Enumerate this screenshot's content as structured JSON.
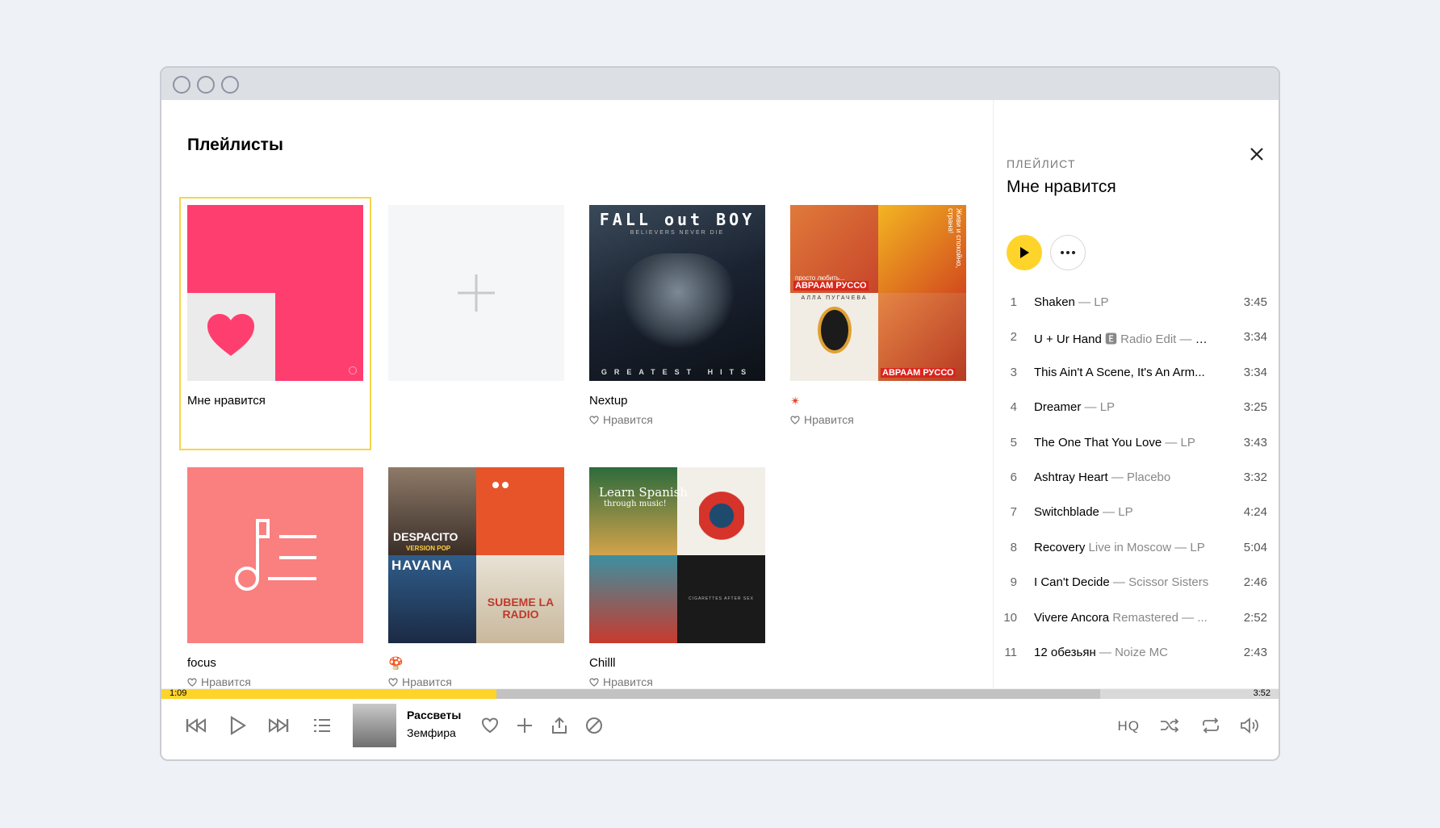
{
  "section_title": "Плейлисты",
  "playlists": [
    {
      "name": "Мне нравится",
      "meta": ""
    },
    {
      "name": "",
      "meta": ""
    },
    {
      "name": "Nextup",
      "meta": "Нравится",
      "cover_text_top": "FALL out BOY",
      "cover_text_sub": "BELIEVERS NEVER DIE",
      "cover_text_bottom": "GREATEST HITS"
    },
    {
      "name": "✴",
      "meta": "Нравится",
      "cover_text_a": "просто любить...",
      "cover_text_b": "АВРААМ РУССО",
      "cover_text_c": "АЛЛА ПУГАЧЕВА",
      "cover_text_d": "Живи и спокойно, страна!"
    },
    {
      "name": "focus",
      "meta": "Нравится"
    },
    {
      "name": "🍄",
      "meta": "Нравится",
      "cover_text_a": "DESPACITO",
      "cover_text_b": "VERSION POP",
      "cover_text_c": "HAVANA",
      "cover_text_d": "SUBEME LA RADIO"
    },
    {
      "name": "Chilll",
      "meta": "Нравится",
      "cover_text_a": "Learn Spanish",
      "cover_text_b": "through music!",
      "cover_text_c": "CIGARETTES AFTER SEX"
    }
  ],
  "panel": {
    "kicker": "ПЛЕЙЛИСТ",
    "title": "Мне нравится",
    "tracks": [
      {
        "num": "1",
        "title": "Shaken",
        "sub": " — LP",
        "duration": "3:45"
      },
      {
        "num": "2",
        "title": "U + Ur Hand",
        "sub": " 🅴 Radio Edit — P!...",
        "duration": "3:34"
      },
      {
        "num": "3",
        "title": "This Ain't A Scene, It's An Arm...",
        "sub": "",
        "duration": "3:34"
      },
      {
        "num": "4",
        "title": "Dreamer",
        "sub": " — LP",
        "duration": "3:25"
      },
      {
        "num": "5",
        "title": "The One That You Love",
        "sub": " — LP",
        "duration": "3:43"
      },
      {
        "num": "6",
        "title": "Ashtray Heart",
        "sub": " — Placebo",
        "duration": "3:32"
      },
      {
        "num": "7",
        "title": "Switchblade",
        "sub": " — LP",
        "duration": "4:24"
      },
      {
        "num": "8",
        "title": "Recovery",
        "sub": " Live in Moscow — LP",
        "duration": "5:04"
      },
      {
        "num": "9",
        "title": "I Can't Decide",
        "sub": " — Scissor Sisters",
        "duration": "2:46"
      },
      {
        "num": "10",
        "title": "Vivere Ancora",
        "sub": " Remastered — ...",
        "duration": "2:52"
      },
      {
        "num": "11",
        "title": "12 обезьян",
        "sub": " — Noize MC",
        "duration": "2:43"
      }
    ]
  },
  "player": {
    "time_current": "1:09",
    "time_total": "3:52",
    "progress": 0.3,
    "buffered": 0.84,
    "track_title": "Рассветы",
    "track_artist": "Земфира",
    "quality_label": "HQ"
  },
  "colors": {
    "accent": "#fed42b",
    "liked_cover": "#ff3e70",
    "focus_cover": "#fa7f7f",
    "selection": "#f6d54b"
  }
}
